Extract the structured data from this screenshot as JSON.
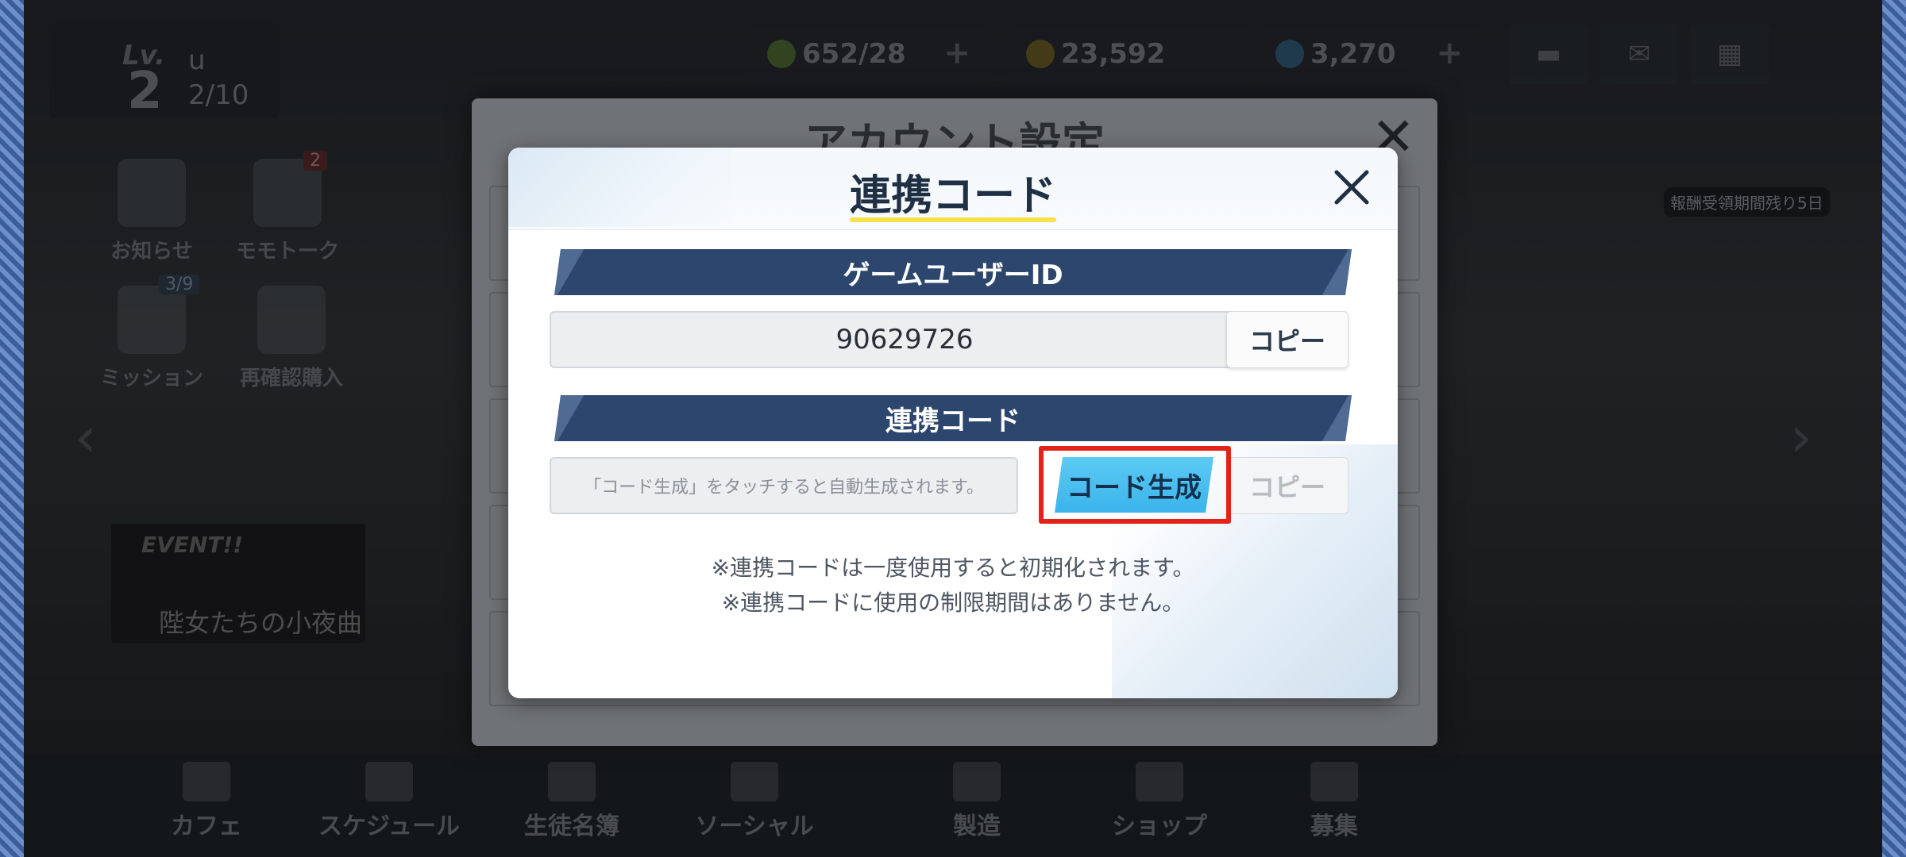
{
  "hud": {
    "lv_label": "Lv.",
    "level": "2",
    "player_name": "u",
    "exp": "2/10",
    "ap": "652/28",
    "credits": "23,592",
    "gems": "3,270",
    "plus": "+"
  },
  "side_menu": {
    "notice": "お知らせ",
    "momotalk": "モモトーク",
    "momotalk_badge": "2",
    "mission": "ミッション",
    "mission_count": "3/9",
    "purchase": "再確認購入"
  },
  "event": {
    "tag": "EVENT!!",
    "title": "陛女たちの小夜曲"
  },
  "right_notice": "報酬受領期間残り5日",
  "bottom_nav": {
    "items": [
      {
        "label": "カフェ"
      },
      {
        "label": "スケジュール"
      },
      {
        "label": "生徒名簿"
      },
      {
        "label": "ソーシャル"
      },
      {
        "label": "製造"
      },
      {
        "label": "ショップ"
      },
      {
        "label": "募集"
      }
    ]
  },
  "outer_dialog": {
    "title": "アカウント設定"
  },
  "modal": {
    "title": "連携コード",
    "user_id_header": "ゲームユーザーID",
    "user_id_value": "90629726",
    "copy_label": "コピー",
    "link_code_header": "連携コード",
    "link_code_placeholder": "「コード生成」をタッチすると自動生成されます。",
    "generate_label": "コード生成",
    "note_1": "※連携コードは一度使用すると初期化されます。",
    "note_2": "※連携コードに使用の制限期間はありません。"
  },
  "colors": {
    "section_bar": "#2d466d",
    "generate_button": "#3bb4ea",
    "highlight": "#e3231a",
    "title_underline": "#f5e14a"
  }
}
